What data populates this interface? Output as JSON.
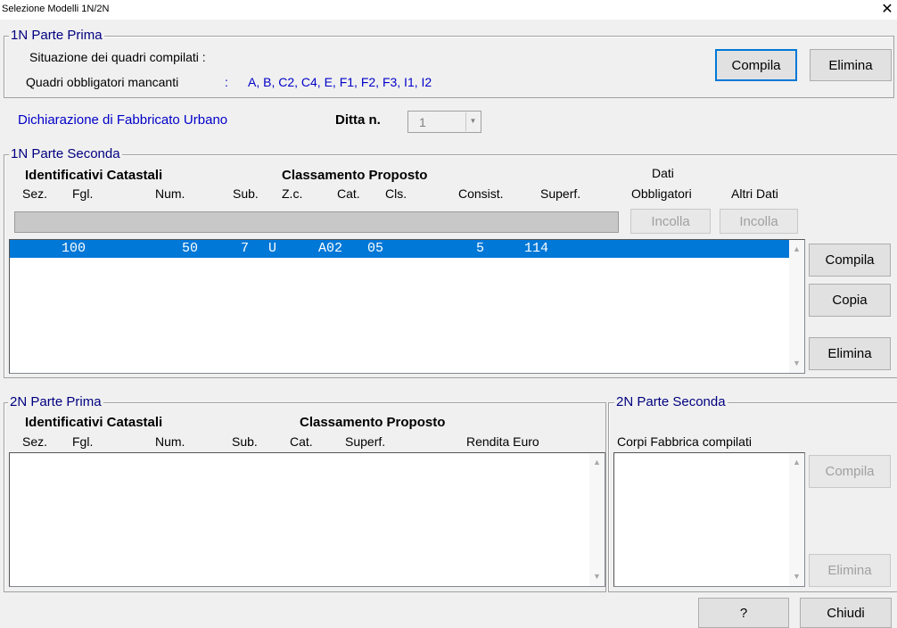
{
  "window": {
    "title": "Selezione Modelli 1N/2N",
    "close_glyph": "✕"
  },
  "p1n_prima": {
    "legend": "1N Parte Prima",
    "situazione_label": "Situazione dei quadri compilati  :",
    "mancanti_label": "Quadri obbligatori mancanti",
    "mancanti_sep": ":",
    "mancanti_value": "A, B, C2, C4, E, F1, F2, F3, I1, I2",
    "compila": "Compila",
    "elimina": "Elimina"
  },
  "fabbricato": {
    "title": "Dichiarazione di Fabbricato Urbano",
    "ditta_label": "Ditta n.",
    "ditta_value": "1"
  },
  "p1n_seconda": {
    "legend": "1N Parte Seconda",
    "group_ident": "Identificativi Catastali",
    "group_class": "Classamento Proposto",
    "dati": "Dati",
    "headers": {
      "sez": "Sez.",
      "fgl": "Fgl.",
      "num": "Num.",
      "sub": "Sub.",
      "zc": "Z.c.",
      "cat": "Cat.",
      "cls": "Cls.",
      "consist": "Consist.",
      "superf": "Superf.",
      "obbligatori": "Obbligatori",
      "altri": "Altri Dati"
    },
    "incolla1": "Incolla",
    "incolla2": "Incolla",
    "row": {
      "fgl": "100",
      "num": "50",
      "sub": "7",
      "zc": "U",
      "cat": "A02",
      "cls": "05",
      "consist": "5",
      "superf": "114"
    },
    "compila": "Compila",
    "copia": "Copia",
    "elimina": "Elimina"
  },
  "p2n_prima": {
    "legend": "2N Parte Prima",
    "group_ident": "Identificativi Catastali",
    "group_class": "Classamento Proposto",
    "headers": {
      "sez": "Sez.",
      "fgl": "Fgl.",
      "num": "Num.",
      "sub": "Sub.",
      "cat": "Cat.",
      "superf": "Superf.",
      "rendita": "Rendita Euro"
    }
  },
  "p2n_seconda": {
    "legend": "2N Parte Seconda",
    "corpi_label": "Corpi Fabbrica compilati",
    "compila": "Compila",
    "elimina": "Elimina"
  },
  "footer": {
    "help": "?",
    "chiudi": "Chiudi"
  }
}
